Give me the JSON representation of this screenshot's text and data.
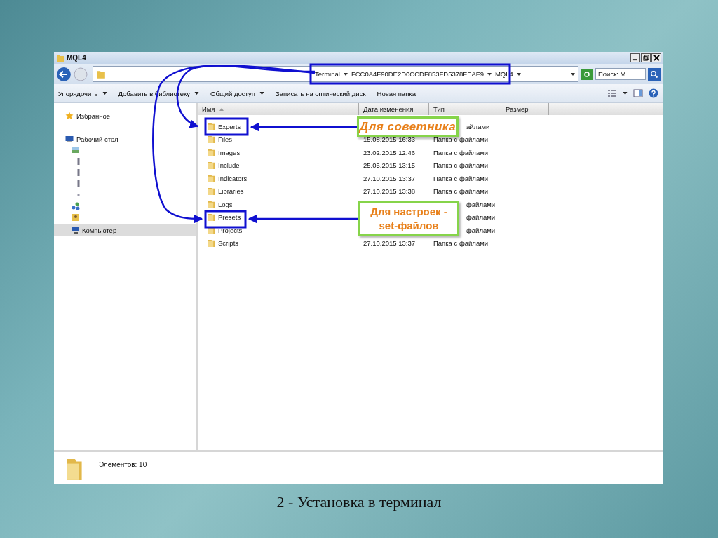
{
  "window": {
    "title": "MQL4"
  },
  "address_bar": {
    "path": [
      {
        "label": "Terminal"
      },
      {
        "label": "FCC0A4F90DE2D0CCDF853FD5378FEAF9"
      },
      {
        "label": "MQL4"
      }
    ]
  },
  "search": {
    "placeholder": "Поиск: M..."
  },
  "toolbar": {
    "items": [
      {
        "label": "Упорядочить",
        "dropdown": true
      },
      {
        "label": "Добавить в библиотеку",
        "dropdown": true
      },
      {
        "label": "Общий доступ",
        "dropdown": true
      },
      {
        "label": "Записать на оптический диск",
        "dropdown": false
      },
      {
        "label": "Новая папка",
        "dropdown": false
      }
    ]
  },
  "sidebar": {
    "items": [
      {
        "kind": "favorites",
        "label": "Избранное",
        "selected": false
      },
      {
        "kind": "desktop",
        "label": "Рабочий стол",
        "selected": false
      },
      {
        "kind": "library",
        "selected": false
      },
      {
        "kind": "drive",
        "selected": false
      },
      {
        "kind": "drive",
        "selected": false
      },
      {
        "kind": "drive",
        "selected": false
      },
      {
        "kind": "item",
        "selected": false
      },
      {
        "kind": "network",
        "selected": false
      },
      {
        "kind": "user",
        "selected": false
      },
      {
        "kind": "computer",
        "label": "Компьютер",
        "selected": true
      }
    ]
  },
  "table": {
    "columns": [
      "Имя",
      "Дата изменения",
      "Тип",
      "Размер"
    ],
    "rows": [
      {
        "name": "Experts",
        "type": "айлами"
      },
      {
        "name": "Files",
        "date": "15.08.2015 16:33",
        "type": "Папка с файлами"
      },
      {
        "name": "Images",
        "date": "23.02.2015 12:46",
        "type": "Папка с файлами"
      },
      {
        "name": "Include",
        "date": "25.05.2015 13:15",
        "type": "Папка с файлами"
      },
      {
        "name": "Indicators",
        "date": "27.10.2015 13:37",
        "type": "Папка с файлами"
      },
      {
        "name": "Libraries",
        "date": "27.10.2015 13:38",
        "type": "Папка с файлами"
      },
      {
        "name": "Logs",
        "type": "файлами"
      },
      {
        "name": "Presets",
        "type": "файлами"
      },
      {
        "name": "Projects",
        "type": "файлами"
      },
      {
        "name": "Scripts",
        "date": "27.10.2015 13:37",
        "type": "Папка с файлами"
      }
    ]
  },
  "status_bar": {
    "text": "Элементов: 10"
  },
  "callouts": [
    {
      "kind": "italic",
      "lines": [
        "Для советника"
      ]
    },
    {
      "kind": "bold",
      "lines": [
        "Для настроек -",
        "set-файлов"
      ]
    }
  ],
  "caption": "2 - Установка в терминал"
}
